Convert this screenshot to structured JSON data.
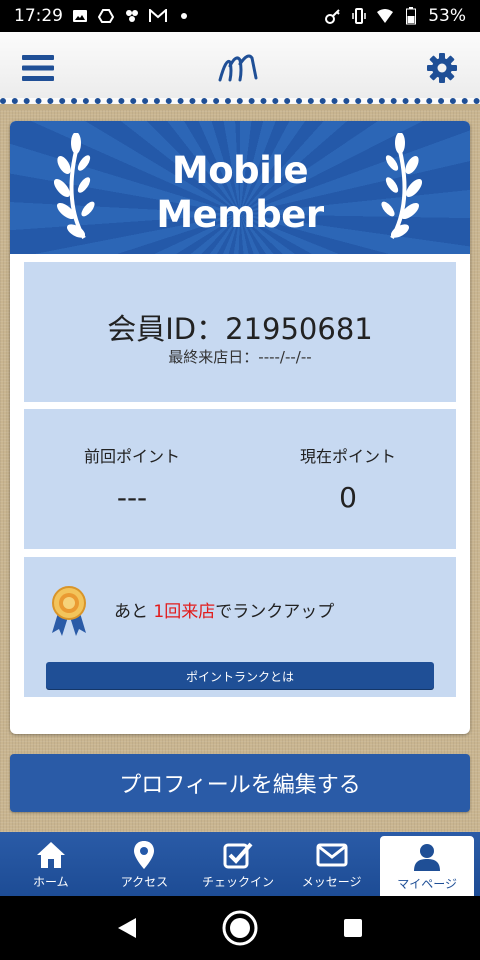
{
  "status_bar": {
    "time": "17:29",
    "notification_icons": [
      "image-icon",
      "drive-icon",
      "pinwheel-icon",
      "gmail-icon",
      "dot-icon"
    ],
    "system_icons": [
      "key-icon",
      "vibrate-icon",
      "wifi-icon",
      "battery-icon"
    ],
    "battery": "53%"
  },
  "header": {
    "menu_icon": "hamburger-menu-icon",
    "logo": "M",
    "settings_icon": "gear-icon"
  },
  "member_card": {
    "banner_title_line1": "Mobile",
    "banner_title_line2": "Member",
    "member_id": "会員ID：21950681",
    "last_visit": "最終来店日：----/--/--",
    "points": {
      "previous_label": "前回ポイント",
      "previous_value": "---",
      "current_label": "現在ポイント",
      "current_value": "0"
    },
    "rank": {
      "prefix": "あと ",
      "highlight": "1回来店",
      "suffix": "でランクアップ",
      "button_label": "ポイントランクとは"
    }
  },
  "edit_profile_label": "プロフィールを編集する",
  "tabbar": {
    "tabs": [
      {
        "label": "ホーム",
        "icon": "home-icon"
      },
      {
        "label": "アクセス",
        "icon": "map-pin-icon"
      },
      {
        "label": "チェックイン",
        "icon": "checkbox-icon"
      },
      {
        "label": "メッセージ",
        "icon": "mail-icon"
      },
      {
        "label": "マイページ",
        "icon": "user-icon",
        "active": true
      }
    ]
  },
  "colors": {
    "primary": "#1f4f96",
    "panel": "#c7d9f1",
    "highlight": "#e21b1b",
    "background": "#c9b590"
  }
}
